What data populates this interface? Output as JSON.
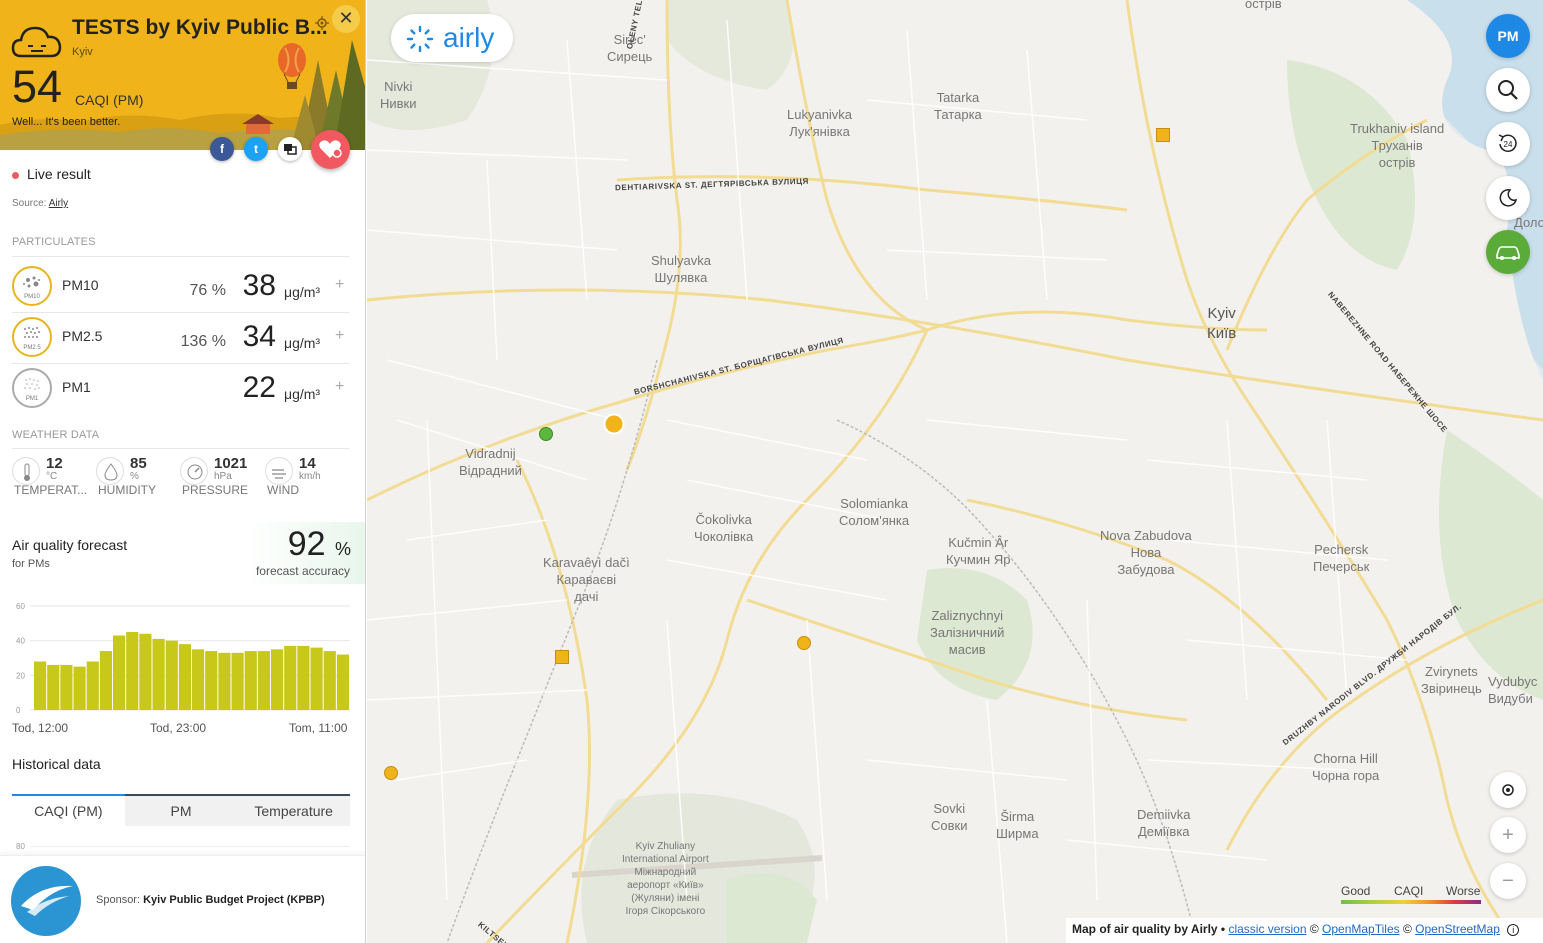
{
  "station": {
    "title": "TESTS by Kyiv Public B...",
    "city": "Kyiv",
    "index_value": "54",
    "index_unit": "CAQI (PM)",
    "message": "Well... It's been better.",
    "live_label": "Live result",
    "source_prefix": "Source:",
    "source_name": "Airly",
    "accent_color": "#f0b41a"
  },
  "social": {
    "facebook": "f",
    "twitter": "t"
  },
  "particulates": {
    "section_title": "PARTICULATES",
    "items": [
      {
        "name": "PM10",
        "tag": "PM10",
        "percent": "76 %",
        "value": "38",
        "unit": "μg/m³",
        "plus": "+"
      },
      {
        "name": "PM2.5",
        "tag": "PM2.5",
        "percent": "136 %",
        "value": "34",
        "unit": "μg/m³",
        "plus": "+"
      },
      {
        "name": "PM1",
        "tag": "PM1",
        "percent": "",
        "value": "22",
        "unit": "μg/m³",
        "plus": "+"
      }
    ]
  },
  "weather": {
    "section_title": "WEATHER DATA",
    "items": [
      {
        "value": "12",
        "unit": "°C",
        "label": "TEMPERAT...",
        "icon": "thermometer-icon"
      },
      {
        "value": "85",
        "unit": "%",
        "label": "HUMIDITY",
        "icon": "humidity-icon"
      },
      {
        "value": "1021",
        "unit": "hPa",
        "label": "PRESSURE",
        "icon": "pressure-icon"
      },
      {
        "value": "14",
        "unit": "km/h",
        "label": "WIND",
        "icon": "wind-icon"
      }
    ]
  },
  "forecast": {
    "title": "Air quality forecast",
    "subtitle": "for PMs",
    "accuracy_value": "92",
    "accuracy_unit": "%",
    "accuracy_label": "forecast accuracy",
    "x_labels": [
      "Tod, 12:00",
      "Tod, 23:00",
      "Tom, 11:00"
    ]
  },
  "chart_data": {
    "type": "bar",
    "title": "",
    "xlabel": "",
    "ylabel": "",
    "ylim": [
      0,
      60
    ],
    "yticks": [
      0,
      20,
      40,
      60
    ],
    "grid": true,
    "color": "#c8c81a",
    "values": [
      28,
      26,
      26,
      25,
      28,
      34,
      43,
      45,
      44,
      41,
      40,
      38,
      35,
      34,
      33,
      33,
      34,
      34,
      35,
      37,
      37,
      36,
      34,
      32
    ]
  },
  "historical": {
    "title": "Historical data",
    "tabs": [
      "CAQI (PM)",
      "PM",
      "Temperature"
    ],
    "active_tab": 0,
    "first_tick": "80"
  },
  "sponsor": {
    "prefix": "Sponsor:",
    "name": "Kyiv Public Budget Project (KPBP)"
  },
  "map": {
    "logo_text": "airly",
    "pm_button": "PM",
    "history_button": "24",
    "legend": {
      "good": "Good",
      "caqi": "CAQI",
      "worse": "Worse"
    },
    "attribution": {
      "prefix": "Map of air quality by Airly •",
      "classic": "classic version",
      "omt": "OpenMapTiles",
      "osm": "OpenStreetMap",
      "copy1": "©",
      "copy2": "©"
    },
    "marker_colors": {
      "good": "#5cb83c",
      "moderate": "#f0b41a"
    }
  },
  "map_labels": {
    "ostriv_top": "острів",
    "sirec": "Sirec'",
    "sirec_ua": "Сирець",
    "nivki": "Nivki",
    "nivki_ua": "Нивки",
    "olenyteliha": "OLENY TELIHY ST. ОЛЕ",
    "lukyanivka": "Lukyanivka",
    "lukyanivka_ua": "Лук'янівка",
    "tatarka": "Tatarka",
    "tatarka_ua": "Татарка",
    "trukhaniv": "Trukhaniv island",
    "trukhaniv_ua": "Труханів",
    "trukhaniv_ua2": "острів",
    "degtiarivska": "DEHTIARIVSKA ST. ДЕГТЯРІВСЬКА ВУЛИЦЯ",
    "shulyavka": "Shulyavka",
    "shulyavka_ua": "Шулявка",
    "kyiv": "Kyiv",
    "kyiv_ua": "Київ",
    "naberezhne": "NABEREZHNE ROAD НАБЕРЕЖНЕ ШОСЕ",
    "borshchahivska": "BORSHCHAHIVSKA ST. БОРЩАГІВСЬКА ВУЛИЦЯ",
    "vidradnyj": "Vidradnij",
    "vidradnyj_ua": "Відрадний",
    "chokolivka": "Čokolivka",
    "chokolivka_ua": "Чоколівка",
    "solomianka": "Solomianka",
    "solomianka_ua": "Солом'янка",
    "kuchmin": "Kučmin Âr",
    "kuchmin_ua": "Кучмин Яр",
    "nova_zabudova": "Nova Zabudova",
    "nova_zabudova_ua": "Нова",
    "nova_zabudova_ua2": "Забудова",
    "pechersk": "Pechersk",
    "pechersk_ua": "Печерськ",
    "karavaevi": "Karavaêvì dačì",
    "karavaevi_ua": "Караваєві",
    "karavaevi_ua2": "дачі",
    "zaliznychnyi": "Zaliznychnyi",
    "zaliznychnyi_ua": "Залізничний",
    "zaliznychnyi_ua2": "масив",
    "druzhby": "DRUZHBY NARODIV BLVD. ДРУЖБИ НАРОДІВ БУЛ.",
    "zvirynets": "Zvirynets",
    "zvirynets_ua": "Звіринець",
    "vydubychi": "Vydubyc",
    "vydubychi_ua": "Видуби",
    "chorna_hora": "Chorna Hill",
    "chorna_hora_ua": "Чорна гора",
    "sovky": "Sovki",
    "sovky_ua": "Совки",
    "shyrma": "Širma",
    "shyrma_ua": "Ширма",
    "demiivka": "Demiivka",
    "demiivka_ua": "Деміївка",
    "airport1": "Kyiv Zhuliany",
    "airport2": "International Airport",
    "airport3": "Міжнародний",
    "airport4": "аеропорт «Київ»",
    "airport5": "(Жуляни) імені",
    "airport6": "Ігоря Сікорського",
    "kiltseva": "KILTSEV",
    "dolo": "Доло",
    "obe": "be"
  }
}
